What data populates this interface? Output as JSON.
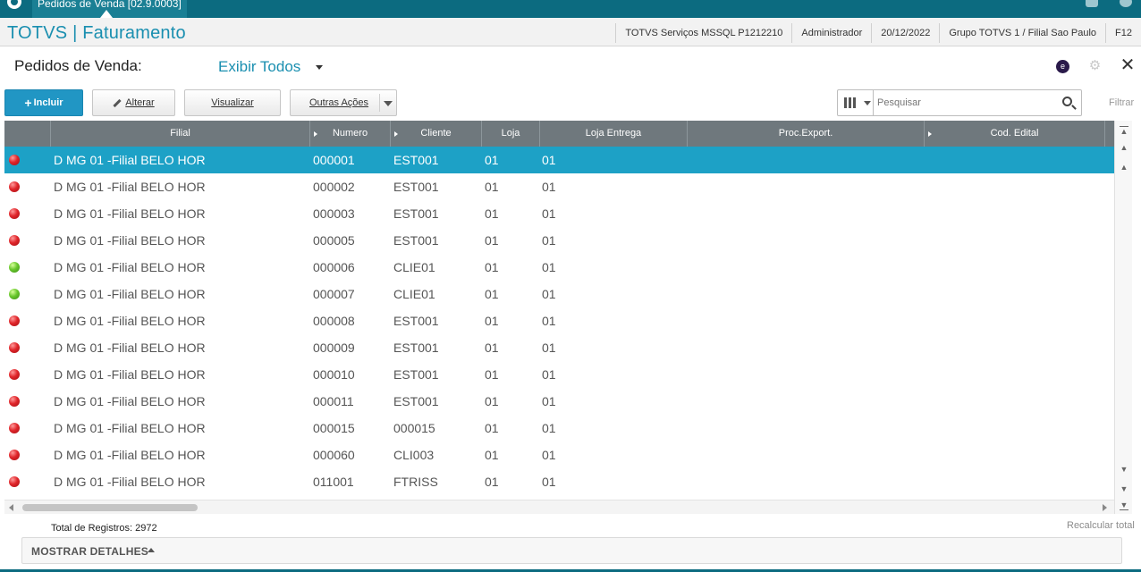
{
  "window": {
    "tab_label": "Pedidos de Venda [02.9.0003]"
  },
  "header": {
    "app_title": "TOTVS | Faturamento",
    "environment": "TOTVS Serviços MSSQL P1212210",
    "user": "Administrador",
    "date": "20/12/2022",
    "branch": "Grupo TOTVS 1 / Filial Sao Paulo",
    "shortcut": "F12"
  },
  "page": {
    "title": "Pedidos de Venda:",
    "view_selected": "Exibir Todos",
    "e_icon_letter": "e"
  },
  "toolbar": {
    "incluir_label": "Incluir",
    "alterar_label": "Alterar",
    "visualizar_label": "Visualizar",
    "outras_label": "Outras Ações"
  },
  "search": {
    "placeholder": "Pesquisar",
    "filter_label": "Filtrar"
  },
  "grid": {
    "columns": [
      "Filial",
      "Numero",
      "Cliente",
      "Loja",
      "Loja Entrega",
      "Proc.Export.",
      "Cod. Edital"
    ],
    "rows": [
      {
        "status": "red",
        "filial": "D MG 01 -Filial BELO HOR",
        "numero": "000001",
        "cliente": "EST001",
        "loja": "01",
        "loja_entrega": "01"
      },
      {
        "status": "red",
        "filial": "D MG 01 -Filial BELO HOR",
        "numero": "000002",
        "cliente": "EST001",
        "loja": "01",
        "loja_entrega": "01"
      },
      {
        "status": "red",
        "filial": "D MG 01 -Filial BELO HOR",
        "numero": "000003",
        "cliente": "EST001",
        "loja": "01",
        "loja_entrega": "01"
      },
      {
        "status": "red",
        "filial": "D MG 01 -Filial BELO HOR",
        "numero": "000005",
        "cliente": "EST001",
        "loja": "01",
        "loja_entrega": "01"
      },
      {
        "status": "green",
        "filial": "D MG 01 -Filial BELO HOR",
        "numero": "000006",
        "cliente": "CLIE01",
        "loja": "01",
        "loja_entrega": "01"
      },
      {
        "status": "green",
        "filial": "D MG 01 -Filial BELO HOR",
        "numero": "000007",
        "cliente": "CLIE01",
        "loja": "01",
        "loja_entrega": "01"
      },
      {
        "status": "red",
        "filial": "D MG 01 -Filial BELO HOR",
        "numero": "000008",
        "cliente": "EST001",
        "loja": "01",
        "loja_entrega": "01"
      },
      {
        "status": "red",
        "filial": "D MG 01 -Filial BELO HOR",
        "numero": "000009",
        "cliente": "EST001",
        "loja": "01",
        "loja_entrega": "01"
      },
      {
        "status": "red",
        "filial": "D MG 01 -Filial BELO HOR",
        "numero": "000010",
        "cliente": "EST001",
        "loja": "01",
        "loja_entrega": "01"
      },
      {
        "status": "red",
        "filial": "D MG 01 -Filial BELO HOR",
        "numero": "000011",
        "cliente": "EST001",
        "loja": "01",
        "loja_entrega": "01"
      },
      {
        "status": "red",
        "filial": "D MG 01 -Filial BELO HOR",
        "numero": "000015",
        "cliente": "000015",
        "loja": "01",
        "loja_entrega": "01"
      },
      {
        "status": "red",
        "filial": "D MG 01 -Filial BELO HOR",
        "numero": "000060",
        "cliente": "CLI003",
        "loja": "01",
        "loja_entrega": "01"
      },
      {
        "status": "red",
        "filial": "D MG 01 -Filial BELO HOR",
        "numero": "011001",
        "cliente": "FTRISS",
        "loja": "01",
        "loja_entrega": "01"
      }
    ],
    "selected_row": 0
  },
  "footer": {
    "total_label": "Total de Registros: 2972",
    "recalc_label": "Recalcular total",
    "details_label": "MOSTRAR DETALHES"
  },
  "colors": {
    "brand": "#1a8fb0",
    "selected_row": "#1da1c6",
    "header_grid": "#6f787d",
    "top_bar": "#0c6b80"
  }
}
